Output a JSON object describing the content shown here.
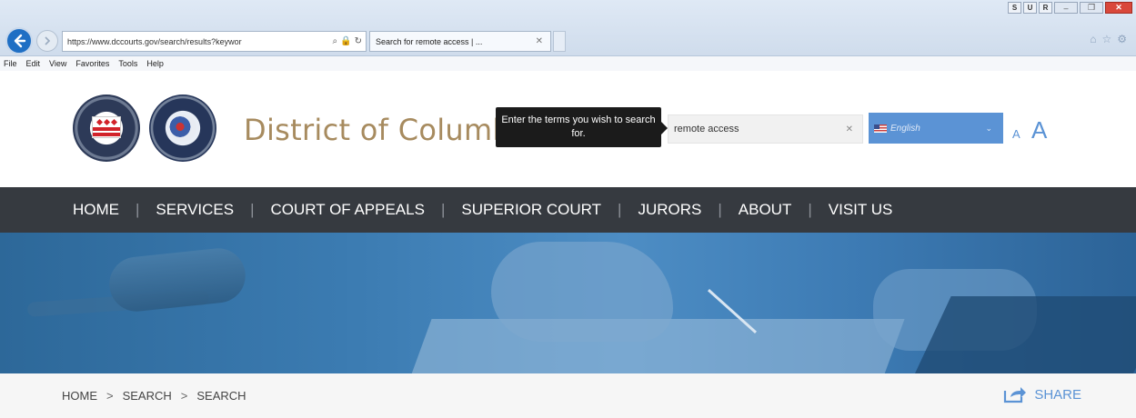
{
  "browser": {
    "url": "https://www.dccourts.gov/search/results?keywor",
    "tab_title": "Search for remote access | ...",
    "window_buttons": [
      "S",
      "U",
      "R"
    ],
    "menu": [
      "File",
      "Edit",
      "View",
      "Favorites",
      "Tools",
      "Help"
    ]
  },
  "header": {
    "site_title": "District of Columbia",
    "tooltip": "Enter the terms you wish to search for.",
    "search_value": "remote access",
    "language": "English",
    "font_small_label": "A",
    "font_large_label": "A"
  },
  "nav": {
    "items": [
      "HOME",
      "SERVICES",
      "COURT OF APPEALS",
      "SUPERIOR COURT",
      "JURORS",
      "ABOUT",
      "VISIT US"
    ]
  },
  "breadcrumb": [
    "HOME",
    "SEARCH",
    "SEARCH"
  ],
  "share_label": "SHARE",
  "colors": {
    "nav_bg": "#363a40",
    "accent_blue": "#5b93d5",
    "title_gold": "#a78b5f"
  }
}
